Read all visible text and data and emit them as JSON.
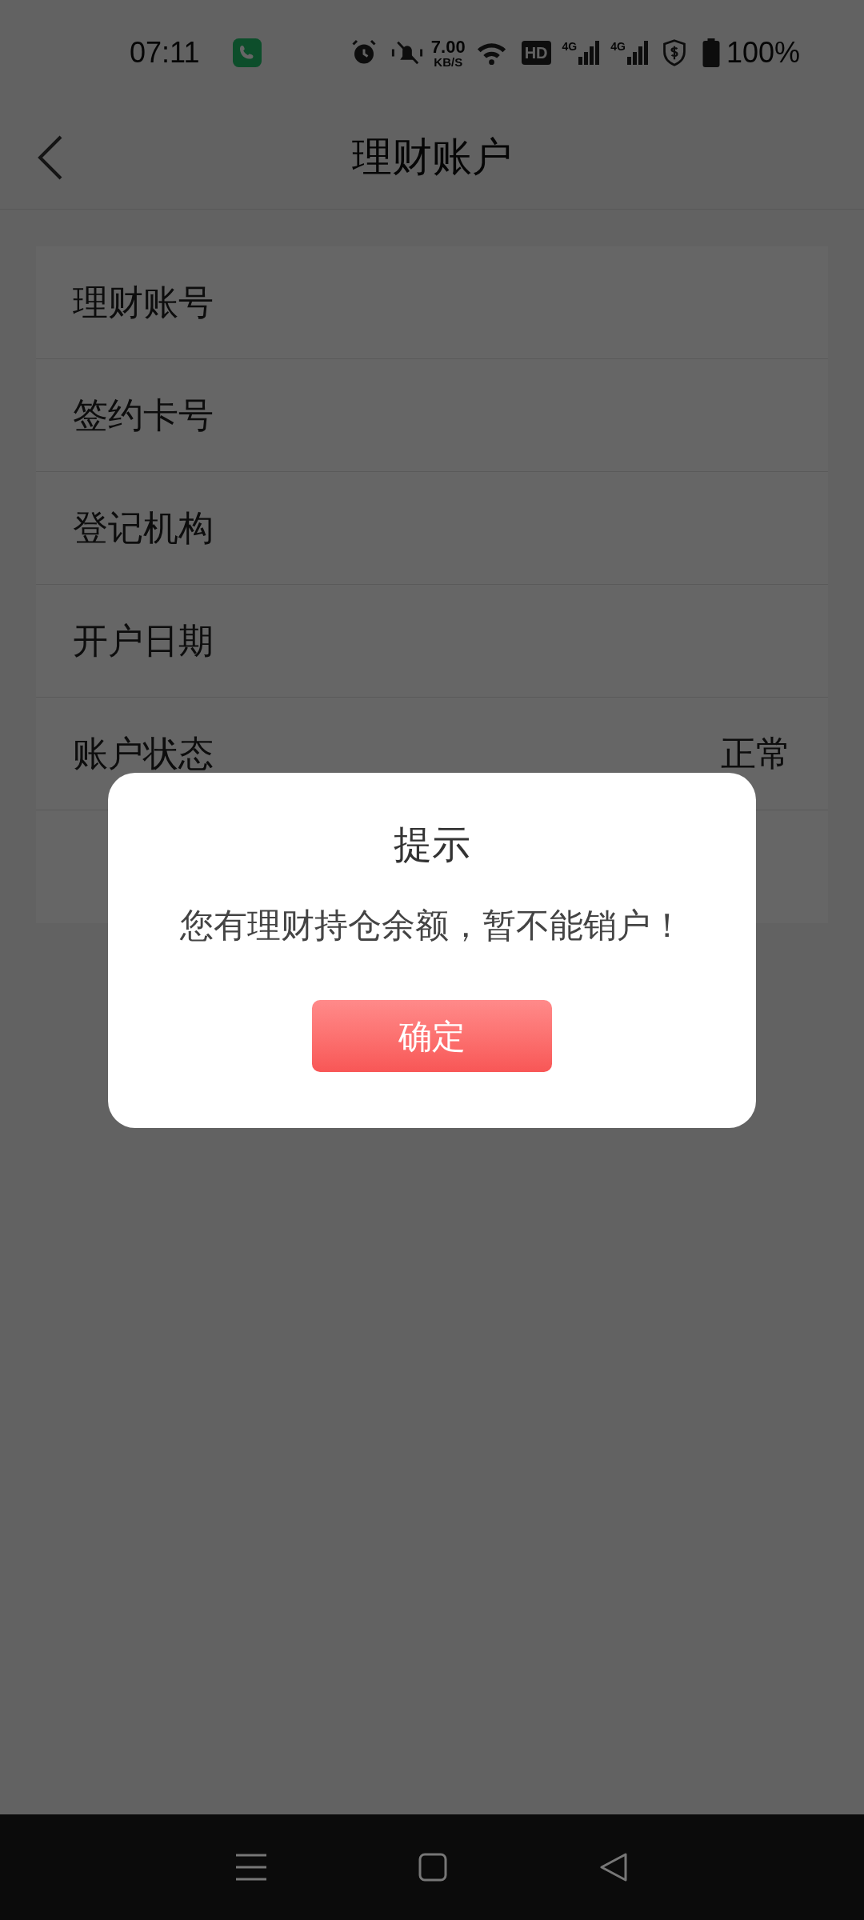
{
  "status_bar": {
    "time": "07:11",
    "speed_value": "7.00",
    "speed_unit": "KB/S",
    "hd": "HD",
    "network_1": "4G",
    "network_2": "4G",
    "battery": "100%"
  },
  "header": {
    "title": "理财账户"
  },
  "rows": [
    {
      "label": "理财账号"
    },
    {
      "label": "签约卡号"
    },
    {
      "label": "登记机构"
    },
    {
      "label": "开户日期"
    },
    {
      "label": "账户状态",
      "value": "正常"
    },
    {
      "label": ""
    }
  ],
  "dialog": {
    "title": "提示",
    "message": "您有理财持仓余额，暂不能销户！",
    "button": "确定"
  }
}
